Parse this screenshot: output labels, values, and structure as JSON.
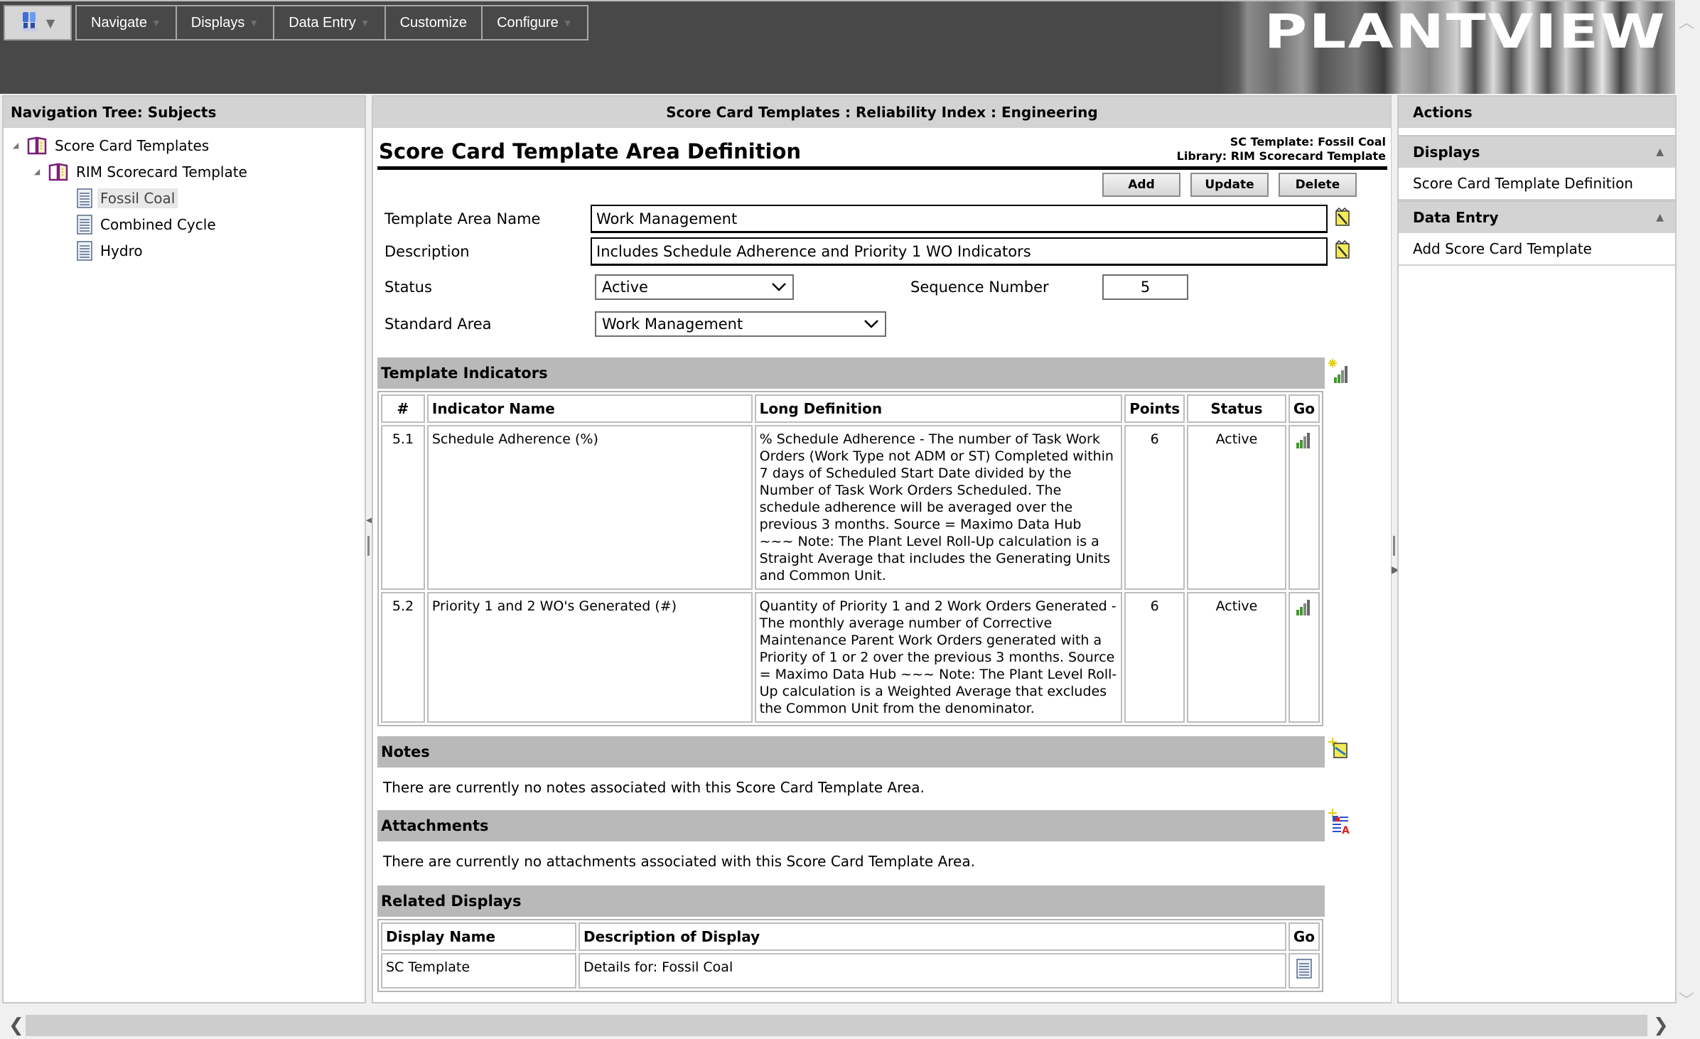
{
  "header": {
    "menu": [
      {
        "label": "Navigate",
        "has_caret": true
      },
      {
        "label": "Displays",
        "has_caret": true
      },
      {
        "label": "Data Entry",
        "has_caret": true
      },
      {
        "label": "Customize",
        "has_caret": false
      },
      {
        "label": "Configure",
        "has_caret": true
      }
    ],
    "logo_text": "PLANTVIEW"
  },
  "left_panel": {
    "title": "Navigation Tree: Subjects",
    "tree": [
      {
        "label": "Score Card Templates",
        "icon": "book-icon",
        "level": 0,
        "expanded": true
      },
      {
        "label": "RIM Scorecard Template",
        "icon": "book-icon",
        "level": 1,
        "expanded": true
      },
      {
        "label": "Fossil Coal",
        "icon": "document-icon",
        "level": 2,
        "selected": true
      },
      {
        "label": "Combined Cycle",
        "icon": "document-icon",
        "level": 2
      },
      {
        "label": "Hydro",
        "icon": "document-icon",
        "level": 2
      }
    ]
  },
  "center_panel": {
    "breadcrumb": "Score Card Templates : Reliability Index : Engineering",
    "page_title": "Score Card Template Area Definition",
    "meta_template": "SC Template: Fossil Coal",
    "meta_library": "Library: RIM Scorecard Template",
    "buttons": {
      "add": "Add",
      "update": "Update",
      "delete": "Delete"
    },
    "form": {
      "template_area_name_label": "Template Area Name",
      "template_area_name_value": "Work Management",
      "description_label": "Description",
      "description_value": "Includes Schedule Adherence and Priority 1 WO Indicators",
      "status_label": "Status",
      "status_value": "Active",
      "sequence_label": "Sequence Number",
      "sequence_value": "5",
      "standard_area_label": "Standard Area",
      "standard_area_value": "Work Management"
    },
    "indicators": {
      "title": "Template Indicators",
      "columns": [
        "#",
        "Indicator Name",
        "Long Definition",
        "Points",
        "Status",
        "Go"
      ],
      "rows": [
        {
          "num": "5.1",
          "name": "Schedule Adherence (%)",
          "definition": "% Schedule Adherence - The number of Task Work Orders (Work Type not ADM or ST) Completed within 7 days of Scheduled Start Date divided by the Number of Task Work Orders Scheduled. The schedule adherence will be averaged over the previous 3 months. Source = Maximo Data Hub ~~~ Note: The Plant Level Roll-Up calculation is a Straight Average that includes the Generating Units and Common Unit.",
          "points": "6",
          "status": "Active"
        },
        {
          "num": "5.2",
          "name": "Priority 1 and 2 WO's Generated (#)",
          "definition": "Quantity of Priority 1 and 2 Work Orders Generated - The monthly average number of Corrective Maintenance Parent Work Orders generated with a Priority of 1 or 2 over the previous 3 months. Source = Maximo Data Hub ~~~ Note: The Plant Level Roll-Up calculation is a Weighted Average that excludes the Common Unit from the denominator.",
          "points": "6",
          "status": "Active"
        }
      ]
    },
    "notes": {
      "title": "Notes",
      "text": "There are currently no notes associated with this Score Card Template Area."
    },
    "attachments": {
      "title": "Attachments",
      "text": "There are currently no attachments associated with this Score Card Template Area."
    },
    "related": {
      "title": "Related Displays",
      "columns": [
        "Display Name",
        "Description of Display",
        "Go"
      ],
      "rows": [
        {
          "name": "SC Template",
          "description": "Details for: Fossil Coal"
        }
      ]
    }
  },
  "right_panel": {
    "title": "Actions",
    "groups": [
      {
        "label": "Displays",
        "items": [
          "Score Card Template Definition"
        ]
      },
      {
        "label": "Data Entry",
        "items": [
          "Add Score Card Template"
        ]
      }
    ]
  }
}
